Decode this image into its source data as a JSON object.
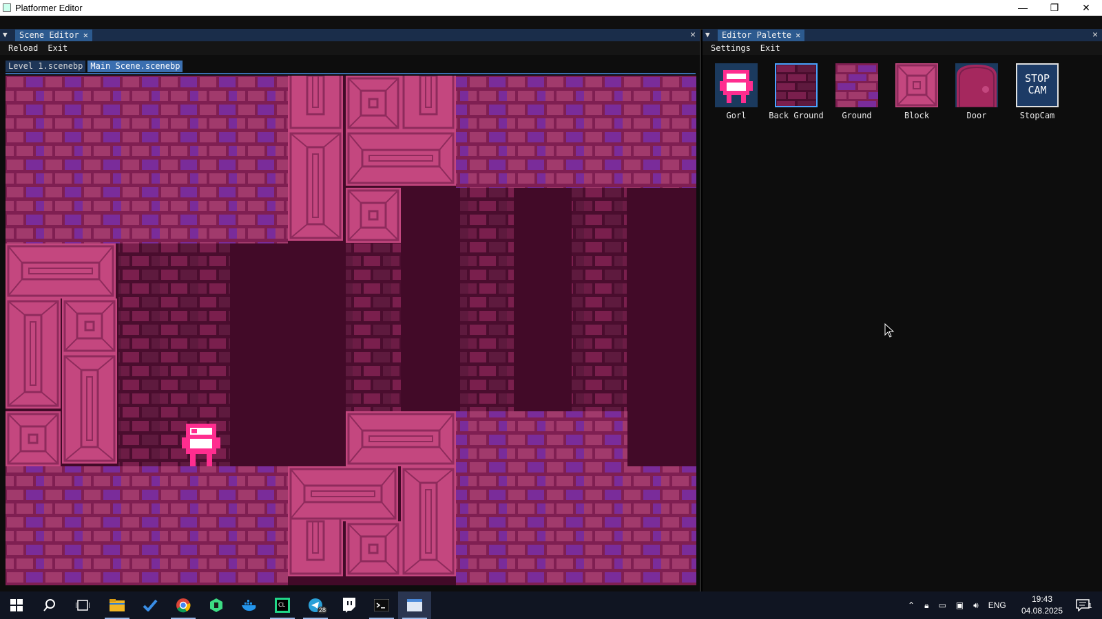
{
  "window": {
    "title": "Platformer Editor",
    "minimize_glyph": "—",
    "maximize_glyph": "❐",
    "close_glyph": "✕"
  },
  "scene_panel": {
    "tab_label": "Scene Editor",
    "menu": {
      "reload": "Reload",
      "exit": "Exit"
    },
    "scene_tabs": [
      {
        "label": "Level 1.scenebp",
        "active": false
      },
      {
        "label": "Main Scene.scenebp",
        "active": true
      }
    ]
  },
  "palette_panel": {
    "tab_label": "Editor Palette",
    "menu": {
      "settings": "Settings",
      "exit": "Exit"
    },
    "items": [
      {
        "label": "Gorl",
        "selected": false,
        "icon": "gorl-character-icon"
      },
      {
        "label": "Back Ground",
        "selected": true,
        "icon": "background-brick-icon"
      },
      {
        "label": "Ground",
        "selected": false,
        "icon": "ground-brick-icon"
      },
      {
        "label": "Block",
        "selected": false,
        "icon": "block-tile-icon"
      },
      {
        "label": "Door",
        "selected": false,
        "icon": "door-icon"
      },
      {
        "label": "StopCam",
        "selected": false,
        "icon": "stopcam-icon",
        "text": "STOP CAM"
      }
    ]
  },
  "colors": {
    "brick": "#a13a6c",
    "brick_purple": "#7a2c9a",
    "block": "#c4477f",
    "block_dark": "#8e2b5c",
    "cavity": "#420a28",
    "dark_brick": "#6a1b44",
    "accent": "#3b6fb0",
    "gorl": "#ff2d8f"
  },
  "taskbar": {
    "apps": [
      "windows-start-icon",
      "search-icon",
      "task-view-icon",
      "file-explorer-icon",
      "todo-icon",
      "chrome-icon",
      "android-studio-icon",
      "docker-icon",
      "clion-icon",
      "telegram-icon",
      "twitch-icon",
      "terminal-icon",
      "editor-app-icon"
    ],
    "telegram_badge": "28",
    "language": "ENG",
    "time": "19:43",
    "date": "04.08.2025",
    "notifications_count": "1"
  }
}
